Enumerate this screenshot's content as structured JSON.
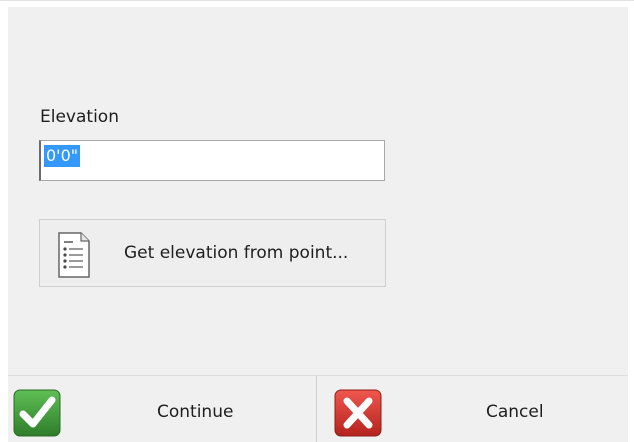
{
  "form": {
    "elevation_label": "Elevation",
    "elevation_value": "0'0\""
  },
  "actions": {
    "get_elevation_label": "Get elevation from point..."
  },
  "footer": {
    "continue_label": "Continue",
    "cancel_label": "Cancel"
  },
  "icons": {
    "get_elevation": "document-list-icon",
    "continue": "checkmark-icon",
    "cancel": "x-icon"
  },
  "colors": {
    "selection": "#3399ff",
    "continue_icon": "#3f9a3a",
    "cancel_icon": "#d9312a"
  }
}
